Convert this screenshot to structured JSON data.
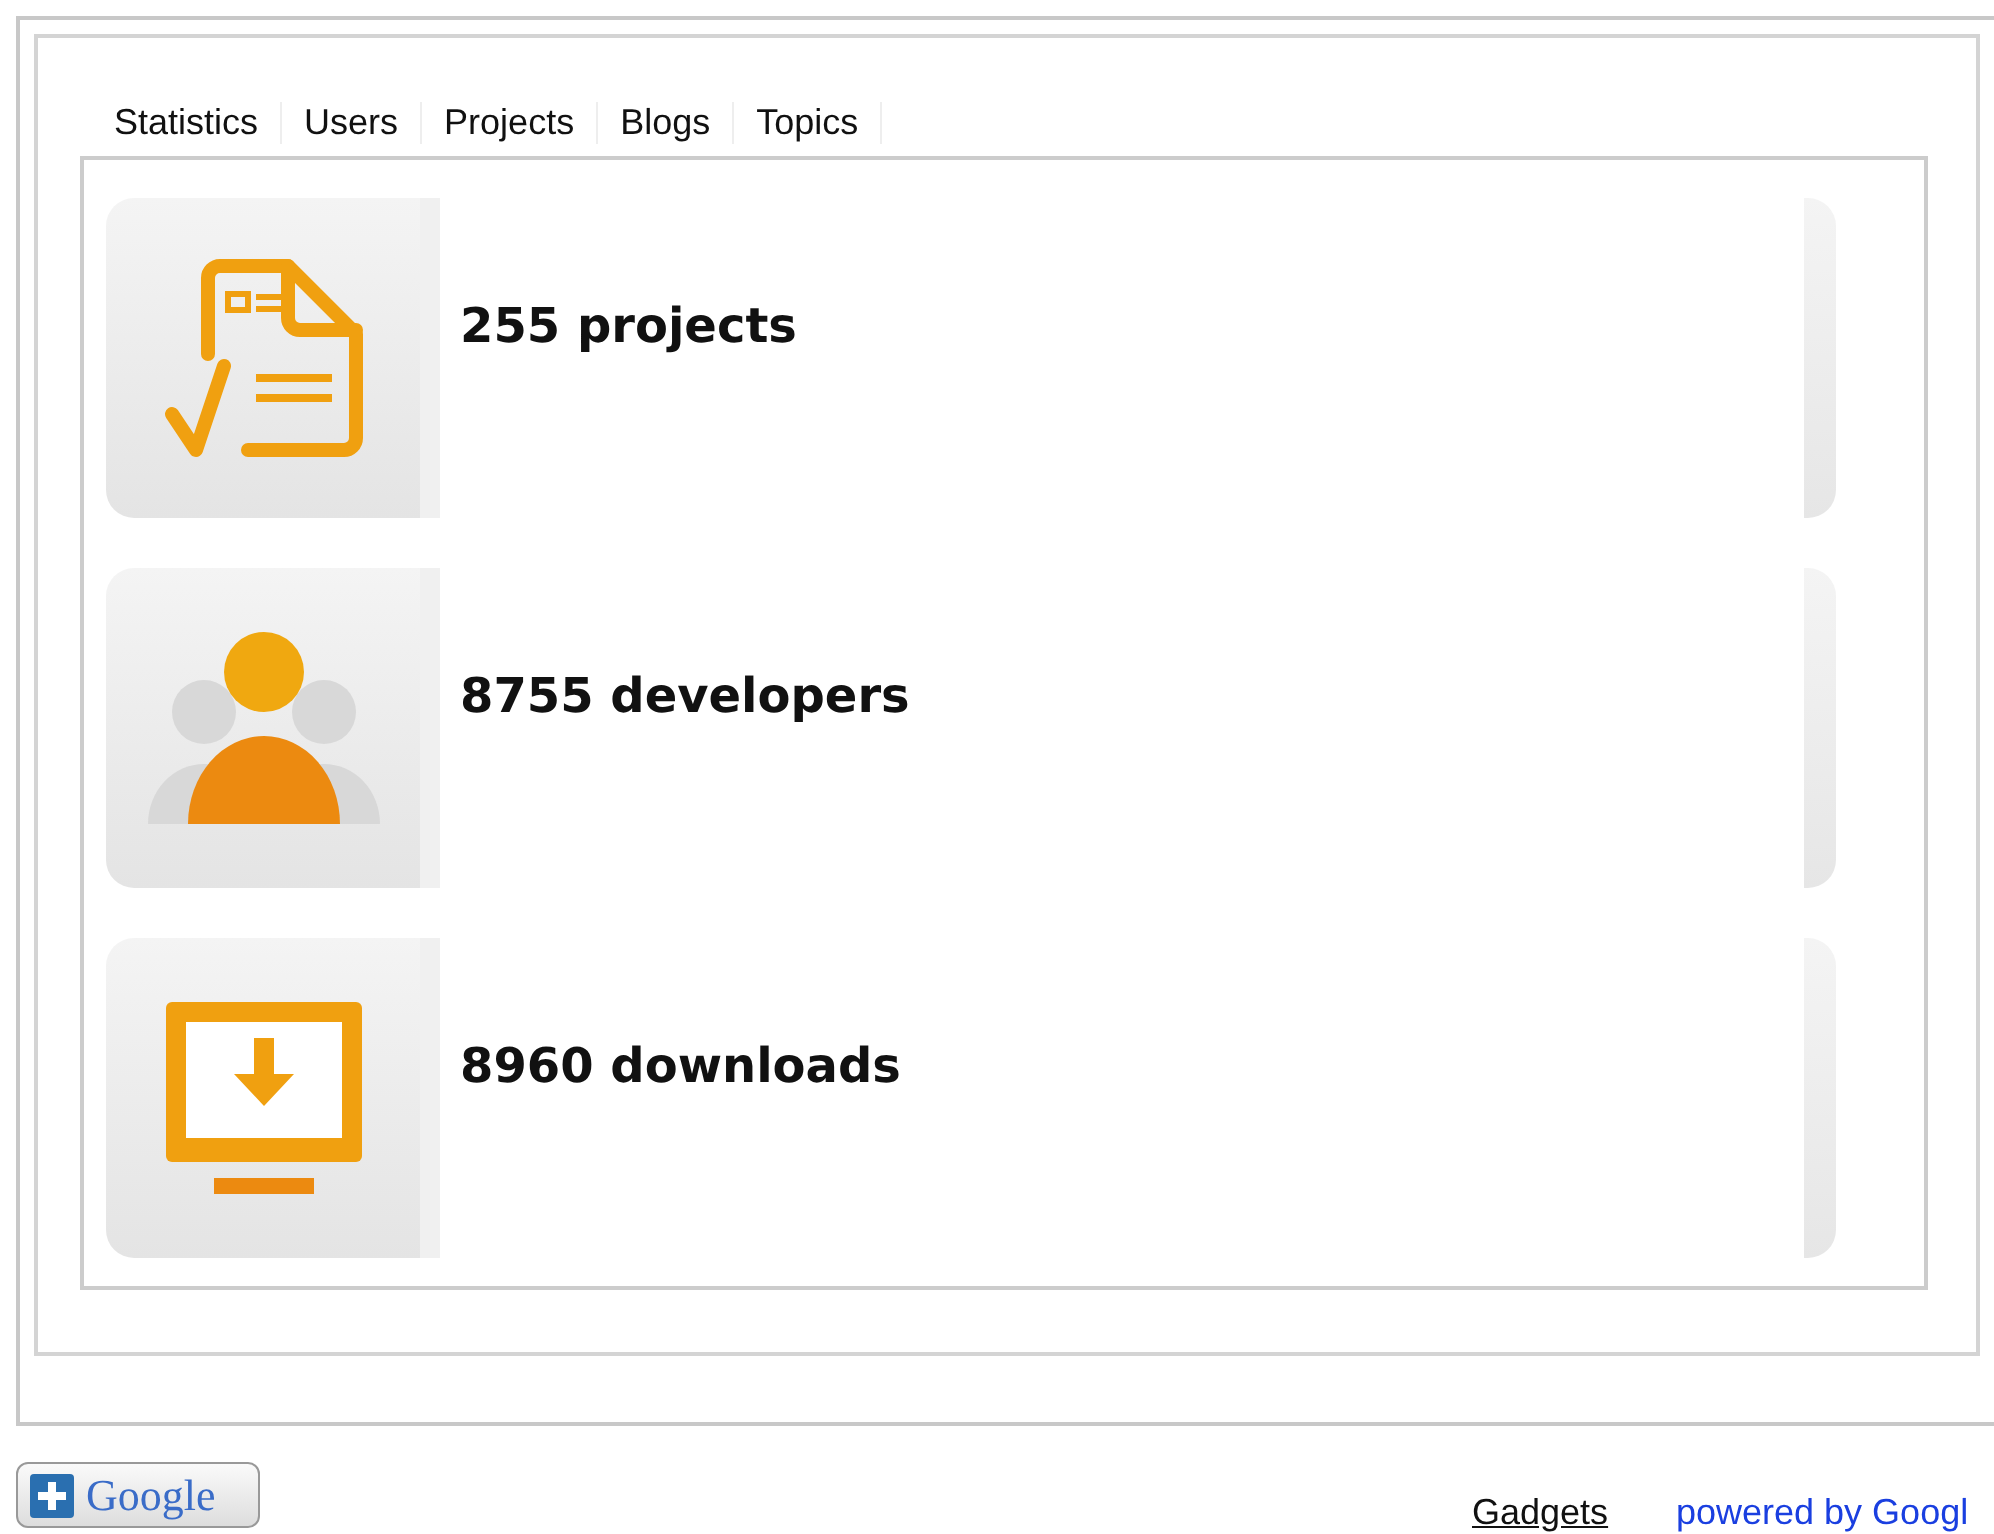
{
  "tabs": [
    {
      "label": "Statistics"
    },
    {
      "label": "Users"
    },
    {
      "label": "Projects"
    },
    {
      "label": "Blogs"
    },
    {
      "label": "Topics"
    }
  ],
  "stats": [
    {
      "kind": "projects",
      "text": "255 projects"
    },
    {
      "kind": "developers",
      "text": "8755 developers"
    },
    {
      "kind": "downloads",
      "text": "8960 downloads"
    }
  ],
  "footer": {
    "add_button": "Google",
    "gadgets_link": "Gadgets",
    "powered_link": "powered by Googl"
  }
}
